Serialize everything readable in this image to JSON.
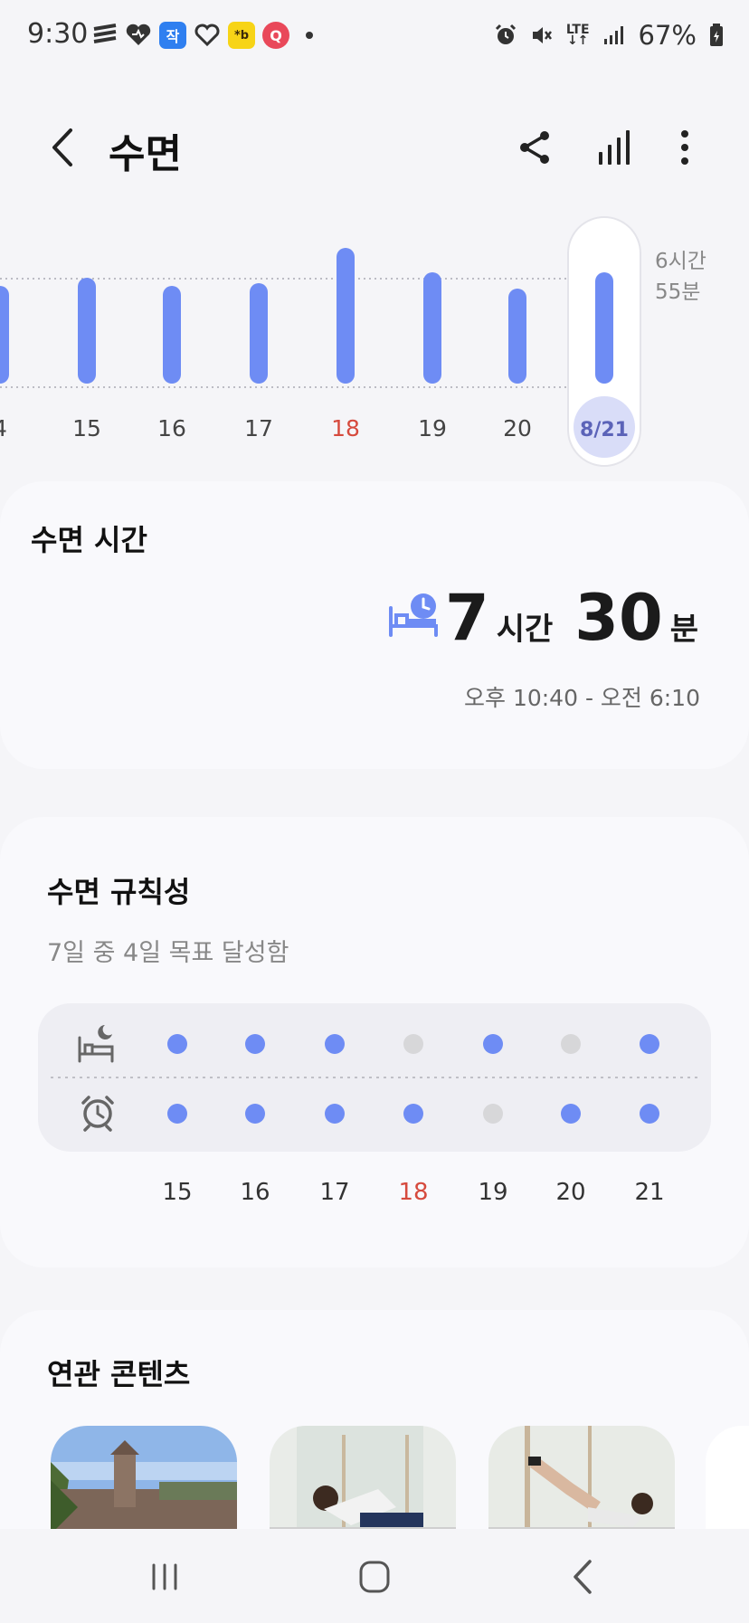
{
  "status_bar": {
    "time": "9:30",
    "battery": "67%",
    "network": "LTE",
    "icons": [
      "flow-icon",
      "heart-icon",
      "app-jak-icon",
      "heart-outline-icon",
      "app-kakao-icon",
      "app-q-icon",
      "dot-icon",
      "alarm-icon",
      "mute-icon",
      "lte-icon",
      "signal-icon",
      "battery-icon"
    ],
    "app_labels": {
      "jak": "작",
      "kakao": "*b",
      "q": "Q"
    }
  },
  "header": {
    "title": "수면",
    "actions": [
      "share-icon",
      "chart-icon",
      "more-icon"
    ]
  },
  "sleep_chart": {
    "dates": [
      "4",
      "15",
      "16",
      "17",
      "18",
      "19",
      "20",
      "8/21"
    ],
    "highlight_date": "18",
    "selected_date": "8/21",
    "goal_line_label_1": "6시간",
    "goal_line_label_2": "55분",
    "relative_values": [
      0.72,
      0.78,
      0.72,
      0.74,
      1.0,
      0.82,
      0.7,
      0.82
    ],
    "colors": {
      "bar": "#6e8cf4",
      "highlight": "#d64a3d",
      "selected_bg": "#d9ddf8"
    }
  },
  "sleep_time": {
    "title": "수면 시간",
    "hours": "7",
    "hours_unit": "시간",
    "minutes": "30",
    "minutes_unit": "분",
    "range": "오후 10:40 - 오전 6:10"
  },
  "regularity": {
    "title": "수면 규칙성",
    "subtitle": "7일 중 4일 목표 달성함",
    "days": [
      "15",
      "16",
      "17",
      "18",
      "19",
      "20",
      "21"
    ],
    "highlight_day": "18",
    "bedtime_met": [
      true,
      true,
      true,
      false,
      true,
      false,
      true
    ],
    "wakeup_met": [
      true,
      true,
      true,
      true,
      false,
      true,
      true
    ],
    "colors": {
      "met": "#6e8cf4",
      "unmet": "#d7d7d9"
    }
  },
  "related": {
    "title": "연관 콘텐츠",
    "items": [
      "abbey-thumbnail",
      "stretch-thumbnail",
      "exercise-thumbnail"
    ]
  },
  "nav": [
    "recents-button",
    "home-button",
    "back-button"
  ]
}
